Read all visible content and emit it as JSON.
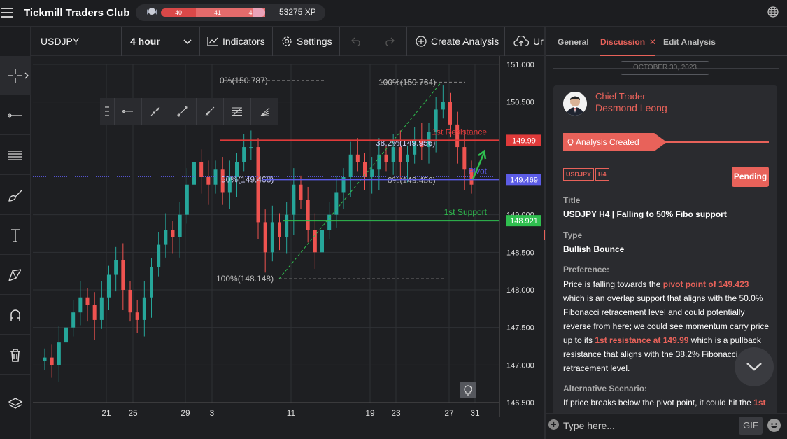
{
  "app": {
    "title": "Tickmill Traders Club",
    "xp_levels": [
      "40",
      "41",
      "42"
    ],
    "xp_value": "53275 XP"
  },
  "toolbar": {
    "symbol": "USDJPY",
    "timeframe": "4 hour",
    "indicators": "Indicators",
    "settings": "Settings",
    "create": "Create Analysis",
    "upload": "Ur"
  },
  "chart_data": {
    "type": "line",
    "symbol": "USDJPY",
    "timeframe": "4 hour",
    "ylim": [
      146.5,
      151.0
    ],
    "y_ticks": [
      "151.000",
      "150.500",
      "149.99",
      "149.469",
      "149.000",
      "148.921",
      "148.500",
      "148.000",
      "147.500",
      "147.000",
      "146.500"
    ],
    "x_tick_labels": [
      "21",
      "25",
      "29",
      "3",
      "11",
      "19",
      "23",
      "27",
      "31"
    ],
    "series": [
      {
        "name": "USDJPY",
        "values": [
          147.1,
          147.0,
          147.3,
          147.5,
          147.7,
          147.9,
          147.8,
          147.6,
          147.9,
          148.2,
          148.4,
          148.0,
          147.7,
          147.6,
          147.9,
          148.3,
          148.6,
          148.8,
          148.7,
          149.0,
          149.4,
          149.7,
          149.5,
          149.4,
          149.6,
          149.3,
          149.5,
          149.7,
          149.9,
          149.9,
          148.9,
          148.5,
          148.9,
          148.7,
          149.0,
          149.4,
          149.2,
          148.8,
          148.5,
          148.8,
          149.0,
          149.3,
          149.5,
          149.8,
          149.7,
          149.5,
          149.6,
          149.8,
          149.7,
          149.9,
          149.7,
          149.8,
          150.0,
          149.9,
          150.1,
          150.4,
          150.5,
          150.2,
          149.9,
          149.6,
          149.4
        ]
      }
    ],
    "levels": [
      {
        "label": "1st Resistance",
        "value": 149.99,
        "tag": "149.99",
        "color": "#e03a3a"
      },
      {
        "label": "Pivot",
        "value": 149.469,
        "tag": "149.469",
        "color": "#5c5ce6"
      },
      {
        "label": "1st Support",
        "value": 148.921,
        "tag": "148.921",
        "color": "#2fbf4f"
      }
    ],
    "fibo": [
      {
        "label": "0%(150.787)",
        "value": 150.787
      },
      {
        "label": "100%(150.764)",
        "value": 150.764
      },
      {
        "label": "38.2%(149.956)",
        "value": 149.956
      },
      {
        "label": "50%(149.468)",
        "value": 149.468
      },
      {
        "label": "0%(149.456)",
        "value": 149.456
      },
      {
        "label": "100%(148.148)",
        "value": 148.148
      }
    ]
  },
  "panel": {
    "tabs": [
      "General",
      "Discussion",
      "Edit Analysis"
    ],
    "date": "OCTOBER 30, 2023",
    "role": "Chief Trader",
    "author": "Desmond Leong",
    "banner": "Analysis Created",
    "tags": [
      "USDJPY",
      "H4"
    ],
    "status": "Pending",
    "title_label": "Title",
    "title": "USDJPY H4 | Falling to 50% Fibo support",
    "type_label": "Type",
    "type": "Bullish Bounce",
    "pref_label": "Preference:",
    "pref_1": "Price is falling towards the ",
    "pref_hl1": "pivot point of 149.423",
    "pref_2": " which is an overlap support that aligns with the 50.0% Fibonacci retracement level and could potentially reverse from here; we could see momentum carry price up to its ",
    "pref_hl2": "1st resistance at 149.99",
    "pref_3": " which is a pullback resistance that aligns with the 38.2% Fibonacci retracement level.",
    "alt_label": "Alternative Scenario:",
    "alt_text": "If price breaks below the pivot point, it could hit the ",
    "alt_hl": "1st",
    "input_placeholder": "Type here...",
    "gif": "GIF"
  }
}
